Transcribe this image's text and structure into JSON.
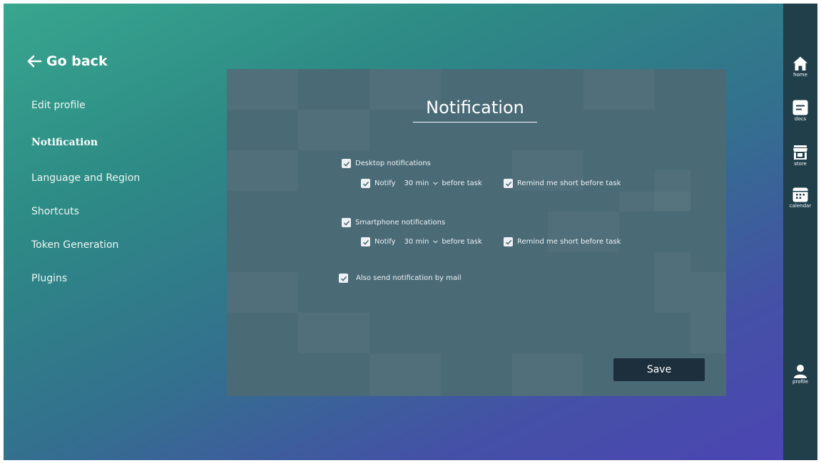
{
  "back": {
    "label": "Go back"
  },
  "menu": {
    "items": [
      {
        "label": "Edit profile",
        "active": false
      },
      {
        "label": "Notification",
        "active": true
      },
      {
        "label": "Language and Region",
        "active": false
      },
      {
        "label": "Shortcuts",
        "active": false
      },
      {
        "label": "Token Generation",
        "active": false
      },
      {
        "label": "Plugins",
        "active": false
      }
    ]
  },
  "panel": {
    "title": "Notification",
    "desktop": {
      "label": "Desktop notifications",
      "checked": true,
      "notify_label": "Notify",
      "notify_checked": true,
      "interval": "30 min",
      "after_label": "before task",
      "remind_label": "Remind me short before task",
      "remind_checked": true
    },
    "smartphone": {
      "label": "Smartphone notifications",
      "checked": true,
      "notify_label": "Notify",
      "notify_checked": true,
      "interval": "30 min",
      "after_label": "before task",
      "remind_label": "Remind me short before task",
      "remind_checked": true
    },
    "mail": {
      "label": "Also send notification by mail",
      "checked": true
    },
    "save_label": "Save"
  },
  "rail": {
    "items": [
      {
        "label": "home",
        "icon": "home-icon"
      },
      {
        "label": "docs",
        "icon": "docs-icon"
      },
      {
        "label": "store",
        "icon": "store-icon"
      },
      {
        "label": "calendar",
        "icon": "calendar-icon"
      },
      {
        "label": "profile",
        "icon": "profile-icon"
      }
    ]
  },
  "colors": {
    "gradient_start": "#38a68f",
    "gradient_end": "#4c44b4",
    "panel": "#4a6a76",
    "rail": "#203f4b",
    "save_button": "#1d2f3c"
  }
}
